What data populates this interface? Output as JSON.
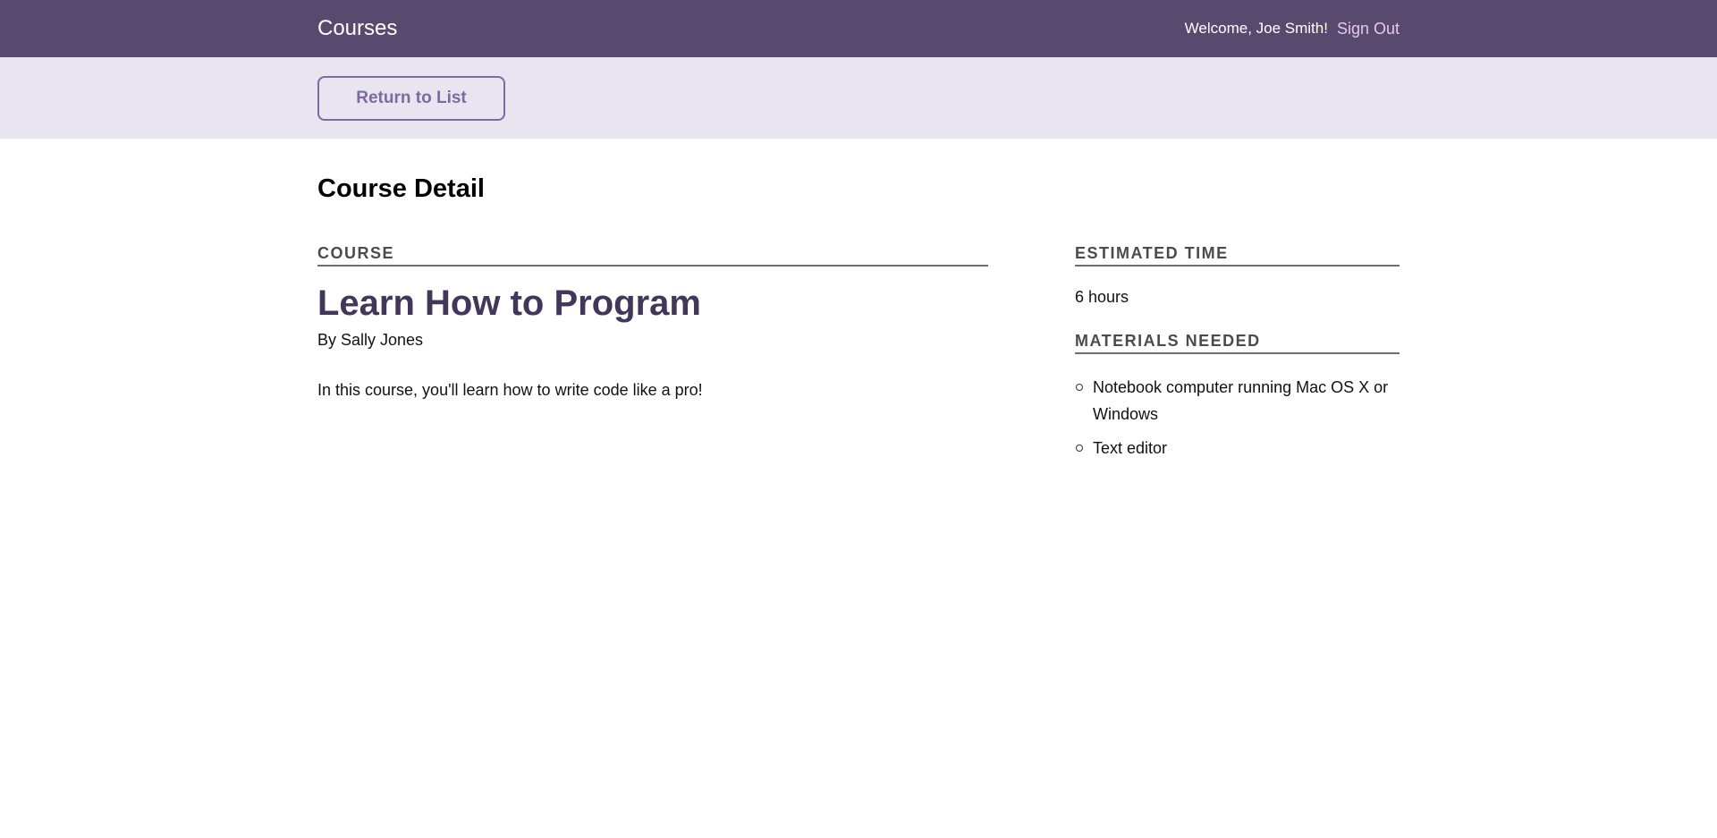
{
  "header": {
    "brand": "Courses",
    "welcome": "Welcome, Joe Smith!",
    "sign_out": "Sign Out"
  },
  "actions": {
    "return_label": "Return to List"
  },
  "page": {
    "title": "Course Detail"
  },
  "course": {
    "section_label": "Course",
    "title": "Learn How to Program",
    "author": "By Sally Jones",
    "description": "In this course, you'll learn how to write code like a pro!"
  },
  "sidebar": {
    "time_label": "Estimated Time",
    "time_value": "6 hours",
    "materials_label": "Materials Needed",
    "materials": [
      "Notebook computer running Mac OS X or Windows",
      "Text editor"
    ]
  },
  "colors": {
    "header_bg": "#584a6f",
    "actions_bg": "#e8e5f1",
    "accent": "#7e6aa0",
    "title": "#423659",
    "sign_out": "#e7c8e8"
  }
}
